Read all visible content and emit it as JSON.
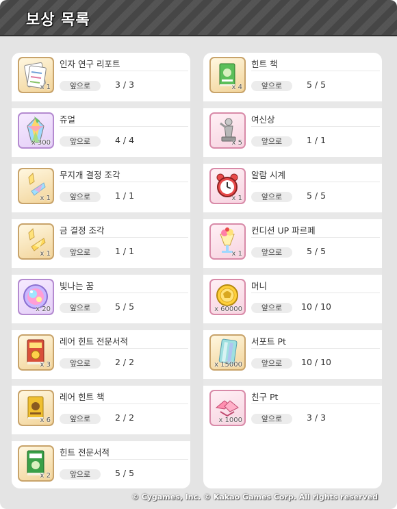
{
  "window": {
    "title": "보상 목록"
  },
  "columns": [
    {
      "items": [
        {
          "name": "인자 연구 리포트",
          "count": "x 1",
          "label": "앞으로",
          "progress": "3 / 3",
          "icon": "report-icon"
        },
        {
          "name": "쥬얼",
          "count": "x 300",
          "label": "앞으로",
          "progress": "4 / 4",
          "icon": "jewel-icon"
        },
        {
          "name": "무지개 결정 조각",
          "count": "x 1",
          "label": "앞으로",
          "progress": "1 / 1",
          "icon": "rainbow-crystal-icon"
        },
        {
          "name": "금 결정 조각",
          "count": "x 1",
          "label": "앞으로",
          "progress": "1 / 1",
          "icon": "gold-crystal-icon"
        },
        {
          "name": "빛나는 꿈",
          "count": "x 20",
          "label": "앞으로",
          "progress": "5 / 5",
          "icon": "shining-dream-icon"
        },
        {
          "name": "레어 힌트 전문서적",
          "count": "x 3",
          "label": "앞으로",
          "progress": "2 / 2",
          "icon": "rare-hint-manual-icon"
        },
        {
          "name": "레어 힌트 책",
          "count": "x 6",
          "label": "앞으로",
          "progress": "2 / 2",
          "icon": "rare-hint-book-icon"
        },
        {
          "name": "힌트 전문서적",
          "count": "x 2",
          "label": "앞으로",
          "progress": "5 / 5",
          "icon": "hint-manual-icon"
        }
      ]
    },
    {
      "items": [
        {
          "name": "힌트 책",
          "count": "x 4",
          "label": "앞으로",
          "progress": "5 / 5",
          "icon": "hint-book-icon"
        },
        {
          "name": "여신상",
          "count": "x 5",
          "label": "앞으로",
          "progress": "1 / 1",
          "icon": "goddess-statue-icon"
        },
        {
          "name": "알람 시계",
          "count": "x 1",
          "label": "앞으로",
          "progress": "5 / 5",
          "icon": "alarm-clock-icon"
        },
        {
          "name": "컨디션 UP 파르페",
          "count": "x 1",
          "label": "앞으로",
          "progress": "5 / 5",
          "icon": "parfait-icon"
        },
        {
          "name": "머니",
          "count": "x 60000",
          "label": "앞으로",
          "progress": "10 / 10",
          "icon": "money-icon"
        },
        {
          "name": "서포트 Pt",
          "count": "x 15000",
          "label": "앞으로",
          "progress": "10 / 10",
          "icon": "support-pt-icon"
        },
        {
          "name": "친구 Pt",
          "count": "x 1000",
          "label": "앞으로",
          "progress": "3 / 3",
          "icon": "friend-pt-icon"
        }
      ]
    }
  ],
  "footer": {
    "copyright": "© Cygames, Inc. © Kakao Games Corp. All rights reserved"
  },
  "colors": {
    "header_bg": "#4a4a4a",
    "panel_bg": "#ffffff",
    "page_bg": "#e4e4e4",
    "icon_border": "#c8a36a",
    "pill_bg": "#ececec"
  }
}
